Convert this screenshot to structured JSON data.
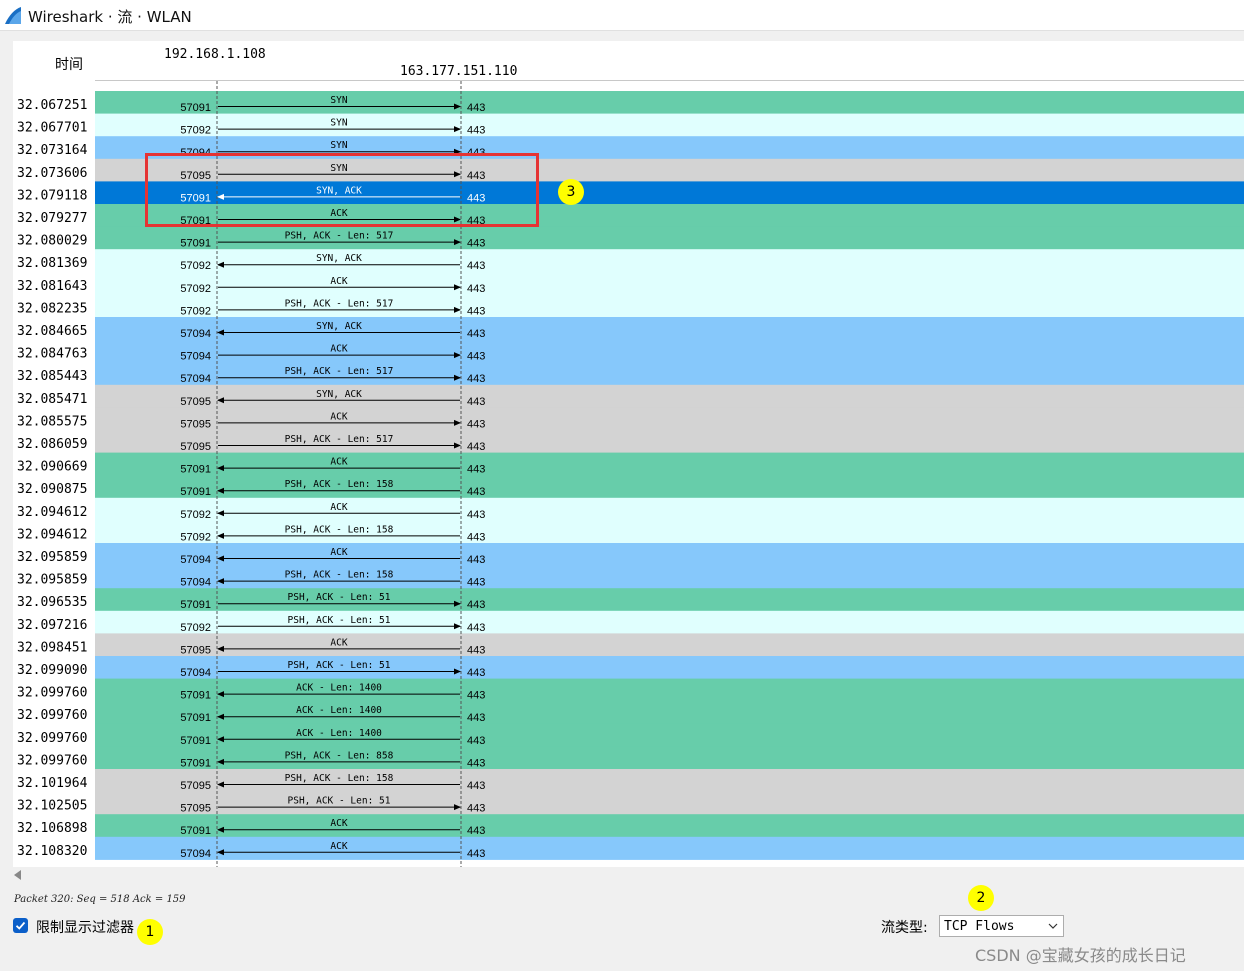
{
  "window": {
    "title": "Wireshark · 流 · WLAN"
  },
  "graph": {
    "time_header": "时间",
    "host_a": "192.168.1.108",
    "host_b": "163.177.151.110",
    "colors": {
      "57091": "#67cdaa",
      "57092": "#e0fffe",
      "57094": "#86c8fb",
      "57095": "#d3d3d3",
      "selected": "#0078d7"
    },
    "rows": [
      {
        "time": "32.067251",
        "src_port": "57091",
        "dst_port": "443",
        "label": "SYN",
        "dir": "right"
      },
      {
        "time": "32.067701",
        "src_port": "57092",
        "dst_port": "443",
        "label": "SYN",
        "dir": "right"
      },
      {
        "time": "32.073164",
        "src_port": "57094",
        "dst_port": "443",
        "label": "SYN",
        "dir": "right"
      },
      {
        "time": "32.073606",
        "src_port": "57095",
        "dst_port": "443",
        "label": "SYN",
        "dir": "right"
      },
      {
        "time": "32.079118",
        "src_port": "57091",
        "dst_port": "443",
        "label": "SYN, ACK",
        "dir": "left",
        "selected": true
      },
      {
        "time": "32.079277",
        "src_port": "57091",
        "dst_port": "443",
        "label": "ACK",
        "dir": "right"
      },
      {
        "time": "32.080029",
        "src_port": "57091",
        "dst_port": "443",
        "label": "PSH, ACK - Len: 517",
        "dir": "right"
      },
      {
        "time": "32.081369",
        "src_port": "57092",
        "dst_port": "443",
        "label": "SYN, ACK",
        "dir": "left"
      },
      {
        "time": "32.081643",
        "src_port": "57092",
        "dst_port": "443",
        "label": "ACK",
        "dir": "right"
      },
      {
        "time": "32.082235",
        "src_port": "57092",
        "dst_port": "443",
        "label": "PSH, ACK - Len: 517",
        "dir": "right"
      },
      {
        "time": "32.084665",
        "src_port": "57094",
        "dst_port": "443",
        "label": "SYN, ACK",
        "dir": "left"
      },
      {
        "time": "32.084763",
        "src_port": "57094",
        "dst_port": "443",
        "label": "ACK",
        "dir": "right"
      },
      {
        "time": "32.085443",
        "src_port": "57094",
        "dst_port": "443",
        "label": "PSH, ACK - Len: 517",
        "dir": "right"
      },
      {
        "time": "32.085471",
        "src_port": "57095",
        "dst_port": "443",
        "label": "SYN, ACK",
        "dir": "left"
      },
      {
        "time": "32.085575",
        "src_port": "57095",
        "dst_port": "443",
        "label": "ACK",
        "dir": "right"
      },
      {
        "time": "32.086059",
        "src_port": "57095",
        "dst_port": "443",
        "label": "PSH, ACK - Len: 517",
        "dir": "right"
      },
      {
        "time": "32.090669",
        "src_port": "57091",
        "dst_port": "443",
        "label": "ACK",
        "dir": "left"
      },
      {
        "time": "32.090875",
        "src_port": "57091",
        "dst_port": "443",
        "label": "PSH, ACK - Len: 158",
        "dir": "left"
      },
      {
        "time": "32.094612",
        "src_port": "57092",
        "dst_port": "443",
        "label": "ACK",
        "dir": "left"
      },
      {
        "time": "32.094612",
        "src_port": "57092",
        "dst_port": "443",
        "label": "PSH, ACK - Len: 158",
        "dir": "left"
      },
      {
        "time": "32.095859",
        "src_port": "57094",
        "dst_port": "443",
        "label": "ACK",
        "dir": "left"
      },
      {
        "time": "32.095859",
        "src_port": "57094",
        "dst_port": "443",
        "label": "PSH, ACK - Len: 158",
        "dir": "left"
      },
      {
        "time": "32.096535",
        "src_port": "57091",
        "dst_port": "443",
        "label": "PSH, ACK - Len: 51",
        "dir": "right"
      },
      {
        "time": "32.097216",
        "src_port": "57092",
        "dst_port": "443",
        "label": "PSH, ACK - Len: 51",
        "dir": "right"
      },
      {
        "time": "32.098451",
        "src_port": "57095",
        "dst_port": "443",
        "label": "ACK",
        "dir": "left"
      },
      {
        "time": "32.099090",
        "src_port": "57094",
        "dst_port": "443",
        "label": "PSH, ACK - Len: 51",
        "dir": "right"
      },
      {
        "time": "32.099760",
        "src_port": "57091",
        "dst_port": "443",
        "label": "ACK - Len: 1400",
        "dir": "left"
      },
      {
        "time": "32.099760",
        "src_port": "57091",
        "dst_port": "443",
        "label": "ACK - Len: 1400",
        "dir": "left"
      },
      {
        "time": "32.099760",
        "src_port": "57091",
        "dst_port": "443",
        "label": "ACK - Len: 1400",
        "dir": "left"
      },
      {
        "time": "32.099760",
        "src_port": "57091",
        "dst_port": "443",
        "label": "PSH, ACK - Len: 858",
        "dir": "left"
      },
      {
        "time": "32.101964",
        "src_port": "57095",
        "dst_port": "443",
        "label": "PSH, ACK - Len: 158",
        "dir": "left"
      },
      {
        "time": "32.102505",
        "src_port": "57095",
        "dst_port": "443",
        "label": "PSH, ACK - Len: 51",
        "dir": "right"
      },
      {
        "time": "32.106898",
        "src_port": "57091",
        "dst_port": "443",
        "label": "ACK",
        "dir": "left"
      },
      {
        "time": "32.108320",
        "src_port": "57094",
        "dst_port": "443",
        "label": "ACK",
        "dir": "left"
      }
    ]
  },
  "status": {
    "packet_info": "Packet 320: Seq = 518 Ack = 159"
  },
  "controls": {
    "limit_filter_label": "限制显示过滤器",
    "limit_filter_checked": true,
    "flow_type_label": "流类型:",
    "flow_type_value": "TCP Flows"
  },
  "annotations": {
    "marker_1": "1",
    "marker_2": "2",
    "marker_3": "3"
  },
  "watermark": "CSDN @宝藏女孩的成长日记"
}
